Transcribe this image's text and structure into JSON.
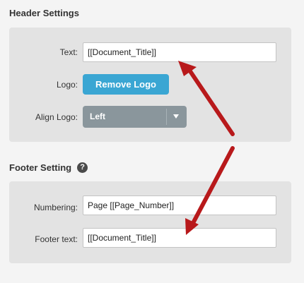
{
  "header_settings": {
    "title": "Header Settings",
    "text_label": "Text:",
    "text_value": "[[Document_Title]]",
    "logo_label": "Logo:",
    "remove_logo_label": "Remove Logo",
    "align_logo_label": "Align Logo:",
    "align_logo_value": "Left"
  },
  "footer_setting": {
    "title": "Footer Setting",
    "help_icon": "?",
    "numbering_label": "Numbering:",
    "numbering_value": "Page [[Page_Number]]",
    "footer_text_label": "Footer text:",
    "footer_text_value": "[[Document_Title]]"
  },
  "colors": {
    "accent_blue": "#3aa6d3",
    "arrow_red": "#b8191b",
    "select_gray": "#8a969c"
  }
}
